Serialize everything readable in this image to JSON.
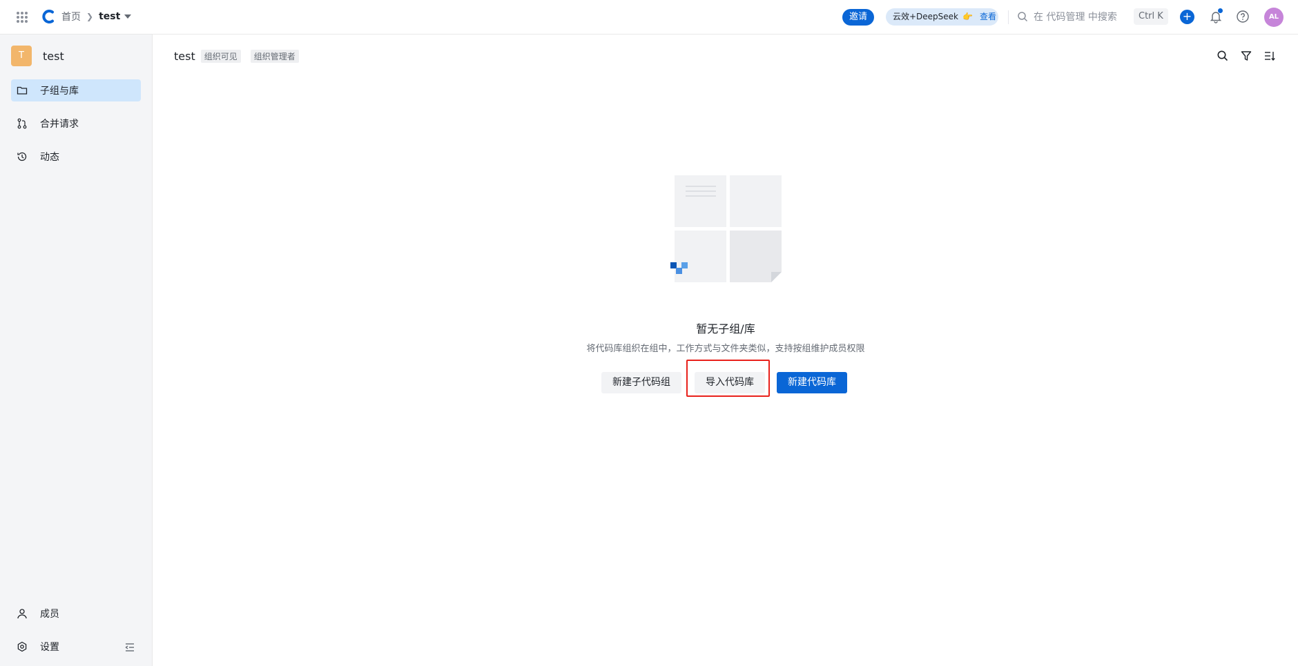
{
  "topbar": {
    "apps_icon": "apps-grid-icon",
    "logo": "codeup-logo-icon",
    "breadcrumb": {
      "home": "首页",
      "current": "test"
    },
    "invite_label": "邀请",
    "promo": {
      "text": "云效+DeepSeek",
      "link": "查看"
    },
    "search_placeholder": "在 代码管理 中搜索",
    "shortcut": "Ctrl K",
    "avatar_initials": "AL",
    "colors": {
      "accent": "#0a66d6",
      "avatar": "#c685d9"
    }
  },
  "sidebar": {
    "group_initial": "T",
    "group_name": "test",
    "group_avatar_color": "#f2b66b",
    "items": [
      {
        "label": "子组与库",
        "icon": "folder-icon",
        "active": true
      },
      {
        "label": "合并请求",
        "icon": "merge-request-icon",
        "active": false
      },
      {
        "label": "动态",
        "icon": "history-icon",
        "active": false
      }
    ],
    "bottom_items": [
      {
        "label": "成员",
        "icon": "user-icon"
      },
      {
        "label": "设置",
        "icon": "settings-icon"
      }
    ]
  },
  "main": {
    "title": "test",
    "tags": [
      "组织可见",
      "组织管理者"
    ],
    "empty": {
      "title": "暂无子组/库",
      "description": "将代码库组织在组中，工作方式与文件夹类似，支持按组维护成员权限",
      "buttons": {
        "new_subgroup": "新建子代码组",
        "import_repo": "导入代码库",
        "new_repo": "新建代码库"
      }
    }
  }
}
